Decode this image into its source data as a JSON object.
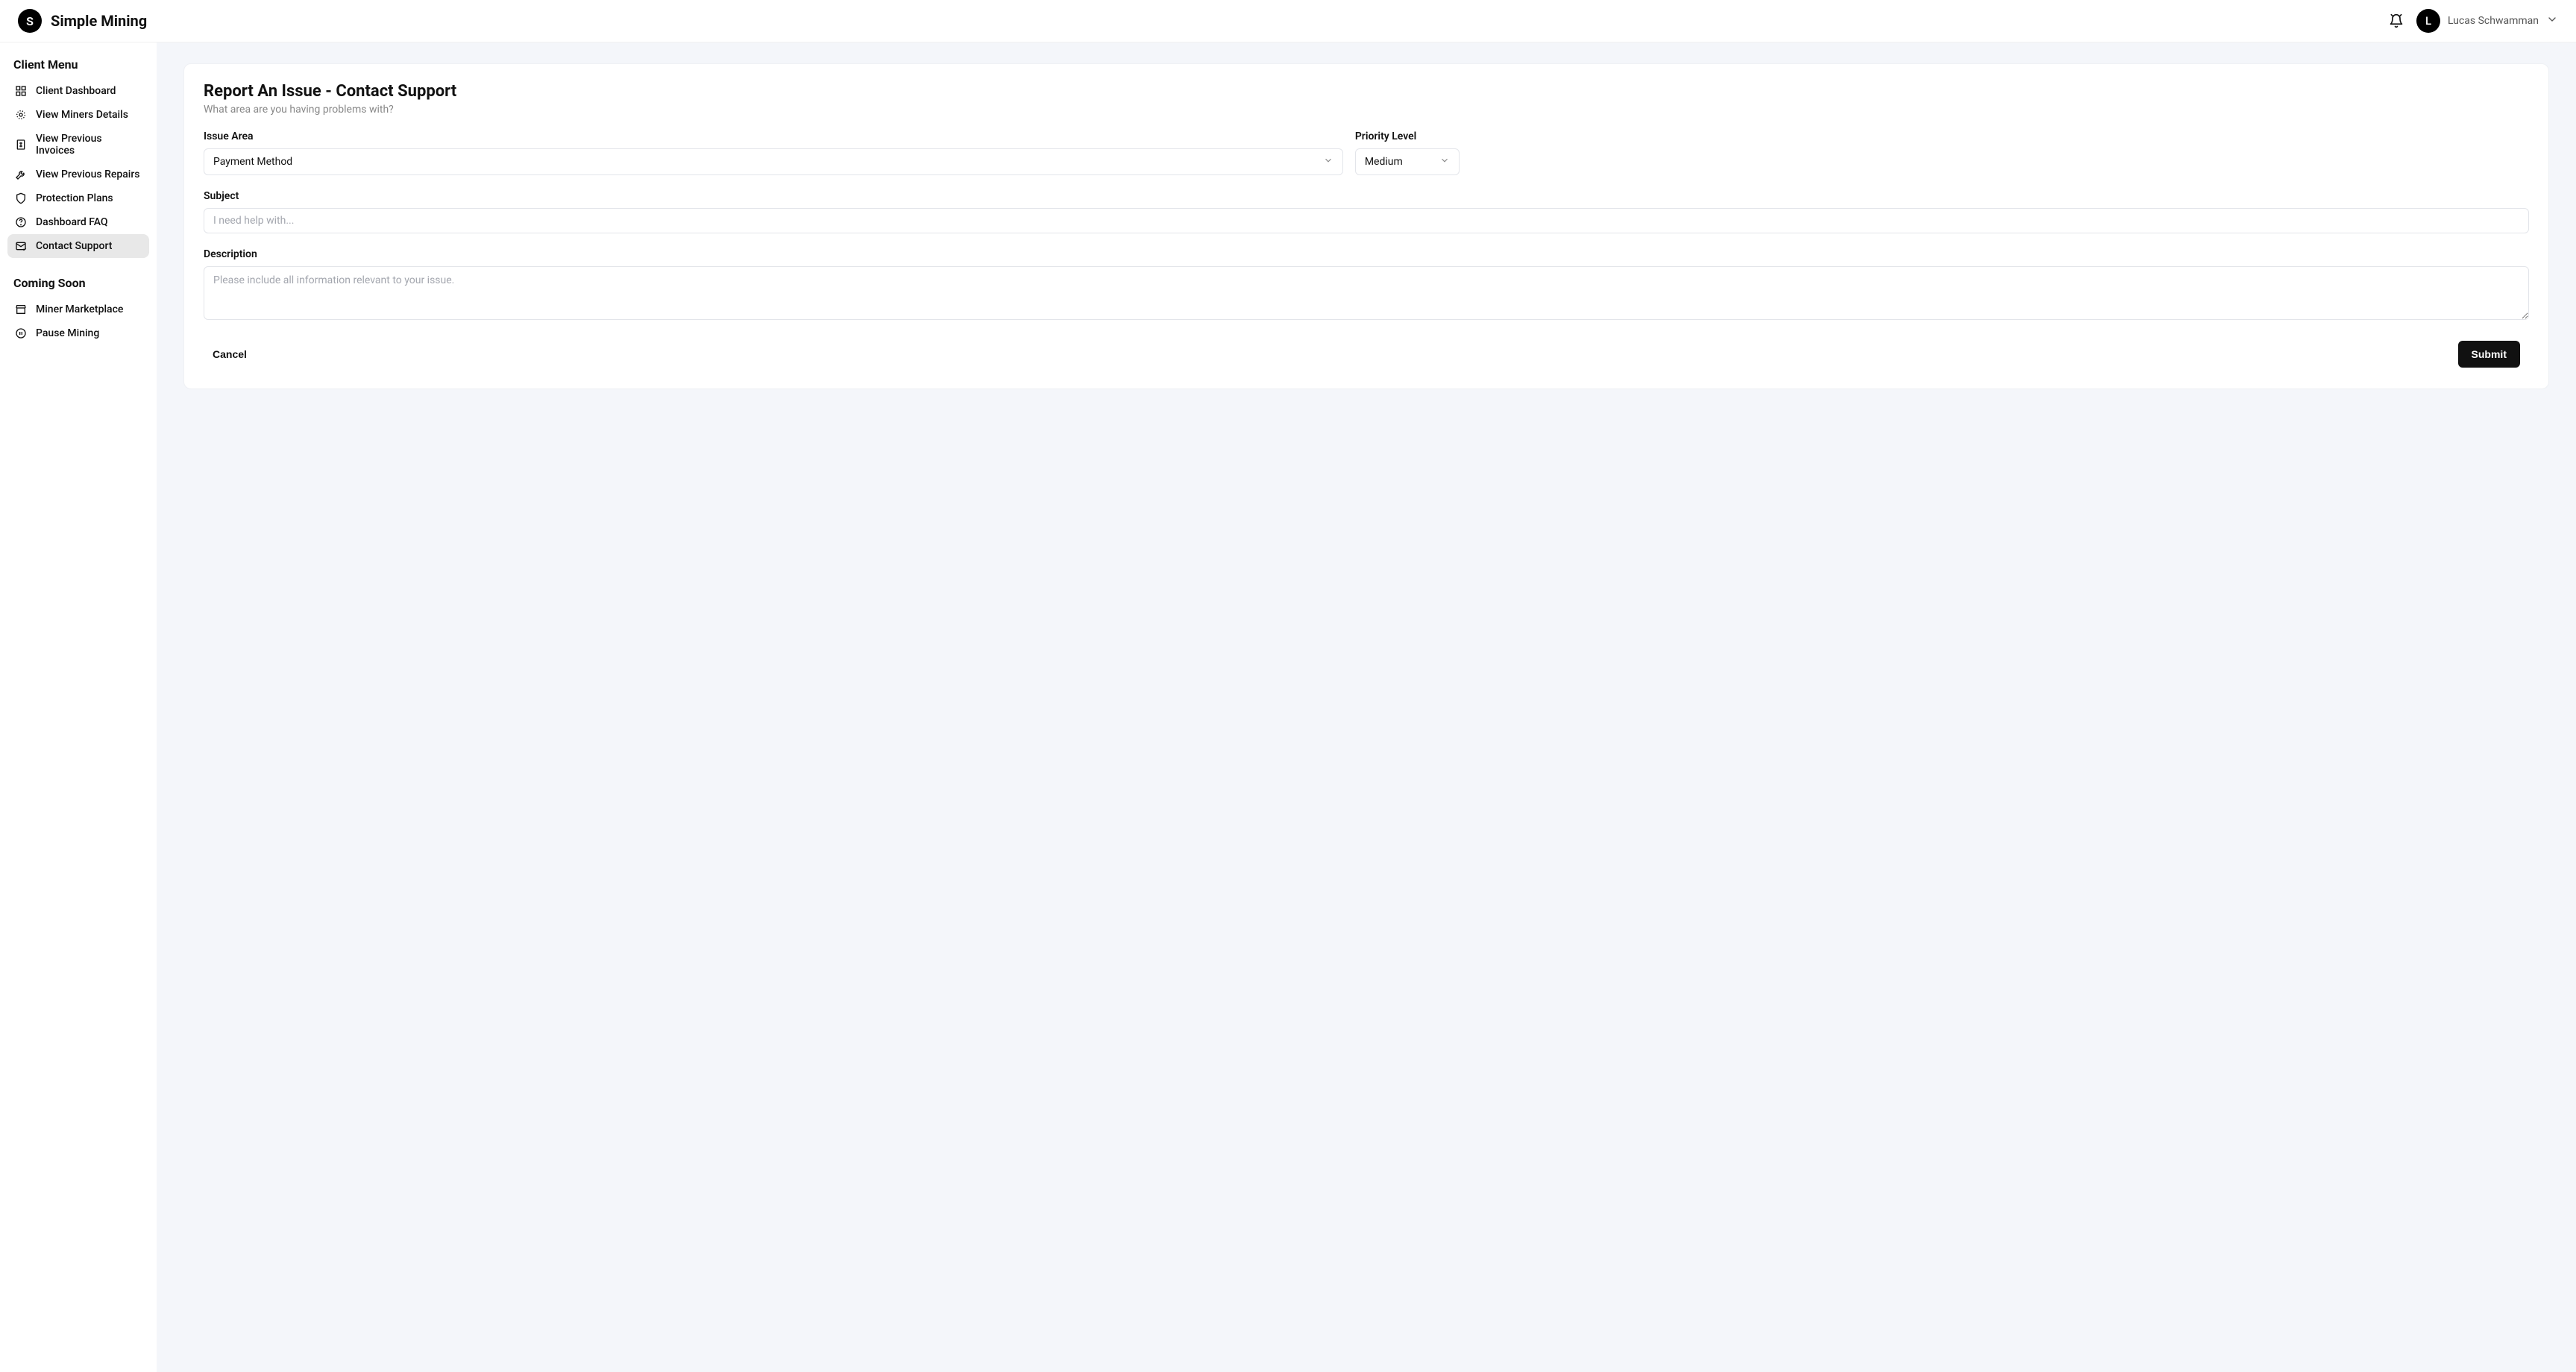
{
  "header": {
    "brand_initial": "S",
    "brand_name": "Simple Mining",
    "avatar_initial": "L",
    "user_name": "Lucas Schwamman"
  },
  "sidebar": {
    "client_menu_heading": "Client Menu",
    "coming_soon_heading": "Coming Soon",
    "client_items": [
      {
        "label": "Client Dashboard"
      },
      {
        "label": "View Miners Details"
      },
      {
        "label": "View Previous Invoices"
      },
      {
        "label": "View Previous Repairs"
      },
      {
        "label": "Protection Plans"
      },
      {
        "label": "Dashboard FAQ"
      },
      {
        "label": "Contact Support"
      }
    ],
    "coming_soon_items": [
      {
        "label": "Miner Marketplace"
      },
      {
        "label": "Pause Mining"
      }
    ]
  },
  "form": {
    "title": "Report An Issue - Contact Support",
    "subtitle": "What area are you having problems with?",
    "issue_area_label": "Issue Area",
    "issue_area_value": "Payment Method",
    "priority_label": "Priority Level",
    "priority_value": "Medium",
    "subject_label": "Subject",
    "subject_placeholder": "I need help with...",
    "description_label": "Description",
    "description_placeholder": "Please include all information relevant to your issue.",
    "cancel_label": "Cancel",
    "submit_label": "Submit"
  }
}
